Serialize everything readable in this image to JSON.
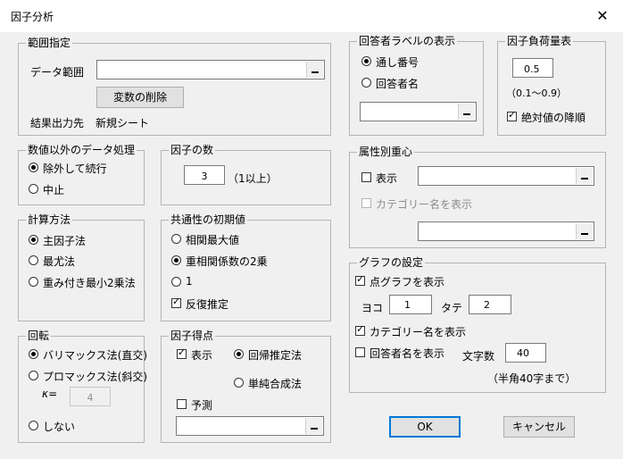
{
  "window": {
    "title": "因子分析",
    "close_glyph": "✕"
  },
  "range": {
    "title": "範囲指定",
    "data_range_label": "データ範囲",
    "data_range_value": "",
    "delete_vars_button": "変数の削除",
    "output_label": "結果出力先",
    "output_value": "新規シート"
  },
  "nonnumeric": {
    "title": "数値以外のデータ処理",
    "options": [
      "除外して続行",
      "中止"
    ],
    "selected": 0
  },
  "num_factors": {
    "title": "因子の数",
    "value": "3",
    "hint": "（1以上）"
  },
  "method": {
    "title": "計算方法",
    "options": [
      "主因子法",
      "最尤法",
      "重み付き最小2乗法"
    ],
    "selected": 0
  },
  "communality": {
    "title": "共通性の初期値",
    "options": [
      "相関最大値",
      "重相関係数の2乗",
      "1"
    ],
    "selected": 1,
    "iterate_label": "反復推定",
    "iterate_checked": true
  },
  "rotation": {
    "title": "回転",
    "options": [
      "バリマックス法(直交)",
      "プロマックス法(斜交)",
      "しない"
    ],
    "selected": 0,
    "kappa_label": "κ=",
    "kappa_value": "4"
  },
  "factor_score": {
    "title": "因子得点",
    "show_label": "表示",
    "show_checked": true,
    "method_options": [
      "回帰推定法",
      "単純合成法"
    ],
    "method_selected": 0,
    "predict_label": "予測",
    "predict_checked": false,
    "predict_value": ""
  },
  "respondent_label": {
    "title": "回答者ラベルの表示",
    "options": [
      "通し番号",
      "回答者名"
    ],
    "selected": 0,
    "value": ""
  },
  "loading": {
    "title": "因子負荷量表",
    "value": "0.5",
    "hint": "（0.1〜0.9）",
    "sort_label": "絶対値の降順",
    "sort_checked": true
  },
  "attribute": {
    "title": "属性別重心",
    "show_label": "表示",
    "show_checked": false,
    "show_value": "",
    "category_label": "カテゴリー名を表示",
    "category_checked": false,
    "category_value": ""
  },
  "graph": {
    "title": "グラフの設定",
    "scatter_label": "点グラフを表示",
    "scatter_checked": true,
    "x_label": "ヨコ",
    "x_value": "1",
    "y_label": "タテ",
    "y_value": "2",
    "category_label": "カテゴリー名を表示",
    "category_checked": true,
    "respondent_label": "回答者名を表示",
    "respondent_checked": false,
    "chars_label": "文字数",
    "chars_value": "40",
    "chars_hint": "（半角40字まで）"
  },
  "buttons": {
    "ok": "OK",
    "cancel": "キャンセル"
  }
}
